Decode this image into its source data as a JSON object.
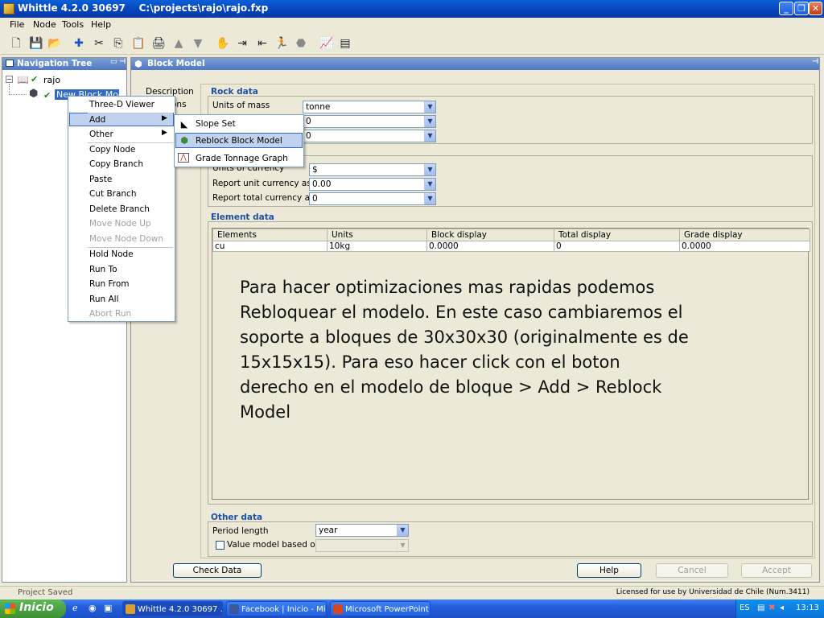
{
  "window": {
    "title": "Whittle 4.2.0 30697    C:\\projects\\rajo\\rajo.fxp"
  },
  "menubar": [
    "File",
    "Node",
    "Tools",
    "Help"
  ],
  "toolbar_icons": [
    "new-icon",
    "save-icon",
    "open-icon",
    "add-node-icon",
    "cut-icon",
    "copy-icon",
    "paste-icon",
    "print-icon",
    "move-up-icon",
    "move-down-icon",
    "hold-icon",
    "run-to-icon",
    "run-from-icon",
    "run-all-icon",
    "abort-icon",
    "graph-icon",
    "table-icon"
  ],
  "nav": {
    "title": "Navigation Tree",
    "root": "rajo",
    "child": "New Block Model"
  },
  "context_menu": {
    "items": [
      {
        "label": "Three-D Viewer",
        "enabled": true
      },
      {
        "label": "Add",
        "enabled": true
      },
      {
        "label": "Other",
        "enabled": true
      },
      {
        "label": "Copy Node",
        "enabled": true
      },
      {
        "label": "Copy Branch",
        "enabled": true
      },
      {
        "label": "Paste",
        "enabled": true
      },
      {
        "label": "Cut Branch",
        "enabled": true
      },
      {
        "label": "Delete Branch",
        "enabled": true
      },
      {
        "label": "Move Node Up",
        "enabled": false
      },
      {
        "label": "Move Node Down",
        "enabled": false
      },
      {
        "label": "Hold Node",
        "enabled": true
      },
      {
        "label": "Run To",
        "enabled": true
      },
      {
        "label": "Run From",
        "enabled": true
      },
      {
        "label": "Run All",
        "enabled": true
      },
      {
        "label": "Abort Run",
        "enabled": false
      }
    ]
  },
  "submenu": {
    "items": [
      {
        "label": "Slope Set",
        "icon": "slope-set-icon"
      },
      {
        "label": "Reblock Block Model",
        "icon": "reblock-icon"
      },
      {
        "label": "Grade Tonnage Graph",
        "icon": "graph-icon"
      }
    ]
  },
  "block_model": {
    "title": "Block Model",
    "side_tabs": [
      "Description",
      "ons"
    ],
    "rock_data": {
      "title": "Rock data",
      "units_of_mass_label": "Units of mass",
      "units_of_mass": "tonne",
      "row2": "0",
      "row3": "0"
    },
    "currency": {
      "units_label": "Units of currency",
      "units": "$",
      "report_unit_label": "Report unit currency as",
      "report_unit": "0.00",
      "report_total_label": "Report total currency as",
      "report_total": "0"
    },
    "element_data": {
      "title": "Element data",
      "columns": [
        "Elements",
        "Units",
        "Block display",
        "Total display",
        "Grade display"
      ],
      "rows": [
        [
          "cu",
          "10kg",
          "0.0000",
          "0",
          "0.0000"
        ]
      ]
    },
    "other_data": {
      "title": "Other data",
      "period_label": "Period length",
      "period": "year",
      "value_model_label": "Value model based on"
    },
    "buttons": {
      "check_data": "Check Data",
      "help": "Help",
      "cancel": "Cancel",
      "accept": "Accept"
    }
  },
  "overlay_text": "Para hacer optimizaciones mas rapidas podemos Rebloquear el modelo. En este caso cambiaremos el soporte a bloques de 30x30x30 (originalmente es de 15x15x15). Para eso hacer click con el boton derecho en el modelo de bloque > Add > Reblock Model",
  "status": {
    "left": "Project Saved",
    "right": "Licensed for use by Universidad de Chile  (Num.3411)"
  },
  "taskbar": {
    "start": "Inicio",
    "items": [
      "Whittle 4.2.0 30697 ...",
      "Facebook | Inicio - Mi...",
      "Microsoft PowerPoint ..."
    ],
    "lang": "ES",
    "clock": "13:13"
  }
}
